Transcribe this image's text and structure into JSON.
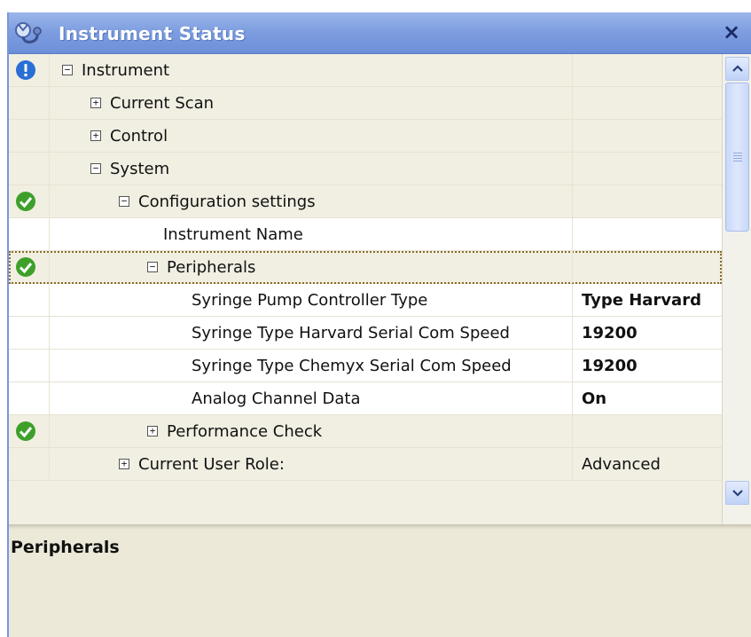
{
  "window": {
    "title": "Instrument Status",
    "title_icon": "stethoscope-icon",
    "close_label": "×"
  },
  "tree": {
    "rows": [
      {
        "label": "Instrument",
        "value": "",
        "status": "info-icon",
        "toggle": "−"
      },
      {
        "label": "Current Scan",
        "value": "",
        "status": "",
        "toggle": "+"
      },
      {
        "label": "Control",
        "value": "",
        "status": "",
        "toggle": "+"
      },
      {
        "label": "System",
        "value": "",
        "status": "",
        "toggle": "−"
      },
      {
        "label": "Configuration settings",
        "value": "",
        "status": "check-icon",
        "toggle": "−"
      },
      {
        "label": "Instrument Name",
        "value": "",
        "status": "",
        "toggle": ""
      },
      {
        "label": "Peripherals",
        "value": "",
        "status": "check-icon",
        "toggle": "−",
        "selected": true
      },
      {
        "label": "Syringe Pump Controller Type",
        "value": "Type Harvard",
        "status": "",
        "toggle": ""
      },
      {
        "label": "Syringe Type Harvard Serial Com Speed",
        "value": "19200",
        "status": "",
        "toggle": ""
      },
      {
        "label": "Syringe Type Chemyx Serial Com Speed",
        "value": "19200",
        "status": "",
        "toggle": ""
      },
      {
        "label": "Analog Channel Data",
        "value": "On",
        "status": "",
        "toggle": ""
      },
      {
        "label": "Performance Check",
        "value": "",
        "status": "check-icon",
        "toggle": "+"
      },
      {
        "label": "Current User Role:",
        "value": "Advanced",
        "status": "",
        "toggle": "+"
      }
    ]
  },
  "description": {
    "title": "Peripherals"
  },
  "colors": {
    "titlebar": "#7e9ee0",
    "info_icon": "#2a6fd6",
    "check_icon": "#3ea02a",
    "panel_bg": "#ece9d8"
  }
}
